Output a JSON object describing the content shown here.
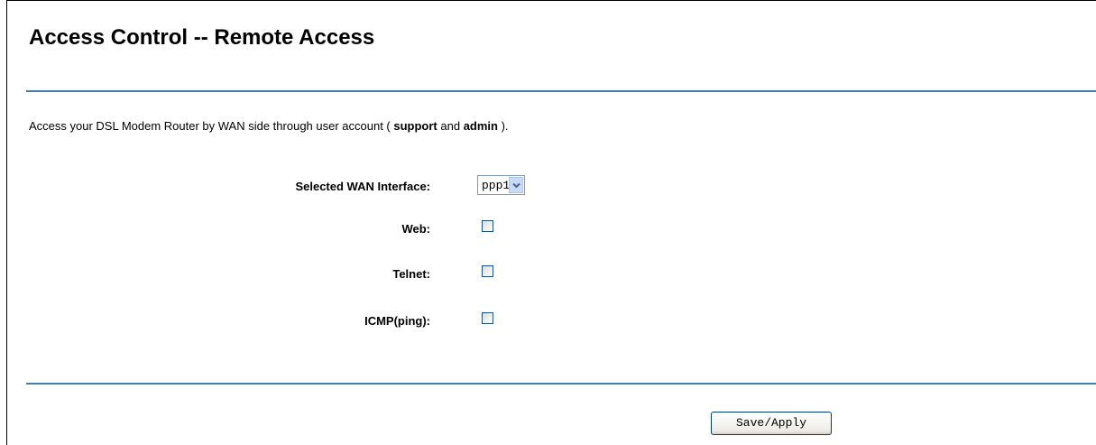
{
  "page": {
    "title": "Access Control -- Remote Access"
  },
  "description": {
    "prefix": "Access your DSL Modem Router by WAN side through user account ( ",
    "user1": "support",
    "middle": " and ",
    "user2": "admin",
    "suffix": " )."
  },
  "form": {
    "wan_interface": {
      "label": "Selected WAN Interface:",
      "selected": "ppp1"
    },
    "web": {
      "label": "Web:",
      "checked": false
    },
    "telnet": {
      "label": "Telnet:",
      "checked": false
    },
    "icmp": {
      "label": "ICMP(ping):",
      "checked": false
    }
  },
  "actions": {
    "save_label": "Save/Apply"
  },
  "colors": {
    "rule": "#3f7fb0"
  },
  "icons": {
    "dropdown": "chevron-down-icon"
  }
}
